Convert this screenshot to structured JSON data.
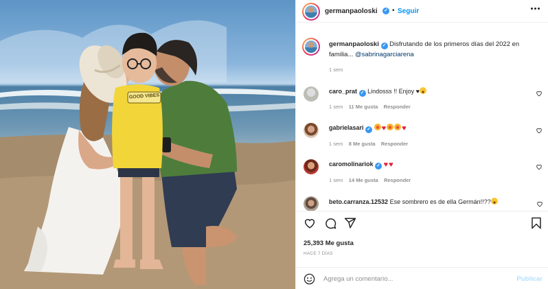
{
  "post": {
    "author": "germanpaoloski",
    "follow_label": "Seguir",
    "separator": "•",
    "caption_text": "Disfrutando de los primeros días del 2022 en familia...",
    "caption_mention": "@sabrinagarciarena",
    "caption_age": "1 sem",
    "likes": "25,393 Me gusta",
    "posted": "HACE 7 DÍAS"
  },
  "comments": [
    {
      "user": "caro_prat",
      "verified": true,
      "text": "Lindosss !! Enjoy ♥",
      "emojis": [
        "laugh"
      ],
      "age": "1 sem",
      "likes": "11 Me gusta",
      "reply": "Responder"
    },
    {
      "user": "gabrielasari",
      "verified": true,
      "text": "",
      "emojis": [
        "star",
        "red",
        "star",
        "star",
        "red"
      ],
      "age": "1 sem",
      "likes": "8 Me gusta",
      "reply": "Responder"
    },
    {
      "user": "caromolinariok",
      "verified": true,
      "text": "",
      "emojis": [
        "red",
        "red"
      ],
      "age": "1 sem",
      "likes": "14 Me gusta",
      "reply": "Responder"
    },
    {
      "user": "beto.carranza.12532",
      "verified": false,
      "text": "Ese sombrero es de ella Germán!!??",
      "emojis": [
        "laugh"
      ]
    }
  ],
  "add_comment": {
    "placeholder": "Agrega un comentario...",
    "publish_label": "Publicar"
  },
  "photo": {
    "shirt_text": "GOOD VIBES"
  },
  "icons": {
    "like": "heart-icon",
    "comment": "comment-icon",
    "share": "paper-plane-icon",
    "save": "bookmark-icon",
    "emoji": "smiley-icon",
    "more": "more-dots-icon"
  },
  "colors": {
    "link_blue": "#0095f6",
    "mention_blue": "#00376b",
    "muted": "#8e8e8e",
    "verified": "#3897f0"
  }
}
